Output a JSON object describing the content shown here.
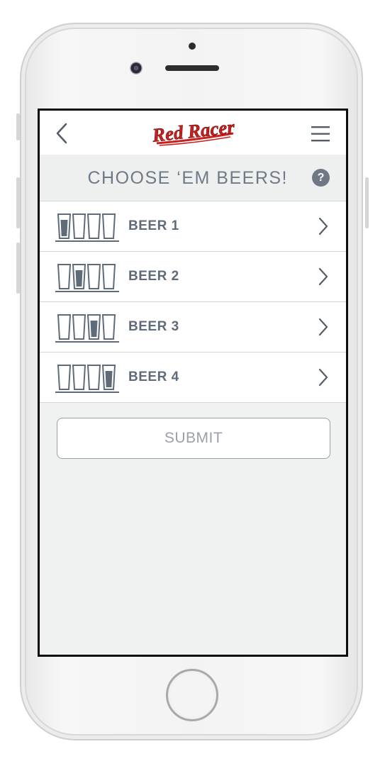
{
  "header": {
    "title": "CHOOSE ‘EM BEERS!",
    "back_icon": "chevron-left-icon",
    "menu_icon": "hamburger-menu-icon",
    "help_icon": "question-icon",
    "help_glyph": "?"
  },
  "brand": {
    "logo_text": "Red Racer",
    "logo_color": "#c8201e"
  },
  "beers": [
    {
      "label": "BEER 1",
      "selected_glass": 1
    },
    {
      "label": "BEER 2",
      "selected_glass": 2
    },
    {
      "label": "BEER 3",
      "selected_glass": 3
    },
    {
      "label": "BEER 4",
      "selected_glass": 4
    }
  ],
  "submit": {
    "label": "SUBMIT"
  },
  "colors": {
    "text_primary": "#5f6b78",
    "accent": "#6e7985",
    "background": "#f0f1f1"
  }
}
